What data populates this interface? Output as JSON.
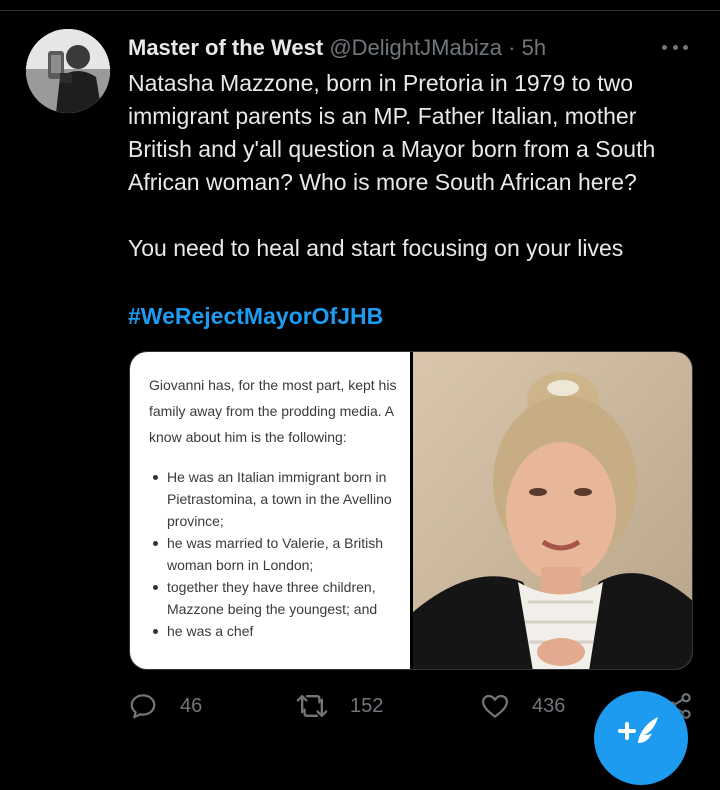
{
  "tweet": {
    "display_name": "Master of the West",
    "handle": "@DelightJMabiza",
    "separator": "·",
    "time": "5h",
    "text_lines_1": [
      "Natasha Mazzone, born in Pretoria in 1979 to two",
      "immigrant parents is an MP. Father Italian, mother",
      "British and y'all question a Mayor born from a South",
      "African woman? Who is more South African here?"
    ],
    "text_line_2": "You need to heal and start focusing on your lives",
    "hashtag": "#WeRejectMayorOfJHB"
  },
  "media": {
    "document": {
      "intro_lines": [
        "Giovanni has, for the most part, kept his",
        "family away from the prodding media. A",
        "know about him is the following:"
      ],
      "bullets": [
        [
          "He was an Italian immigrant born in",
          "Pietrastomina, a town in the Avellino",
          "province;"
        ],
        [
          "he was married to Valerie, a British",
          "woman born in London;"
        ],
        [
          "together they have three children,",
          "Mazzone being the youngest; and"
        ],
        [
          "he was a chef"
        ]
      ]
    },
    "photo_icon": "portrait-photo"
  },
  "actions": {
    "reply_count": "46",
    "retweet_count": "152",
    "like_count": "436"
  },
  "icons": {
    "reply": "reply-icon",
    "retweet": "retweet-icon",
    "like": "heart-icon",
    "share": "share-icon",
    "more": "more-icon",
    "compose": "compose-tweet-icon"
  },
  "colors": {
    "background": "#000000",
    "accent": "#1d9bf0",
    "muted": "#71767b",
    "text": "#e7e9ea"
  }
}
